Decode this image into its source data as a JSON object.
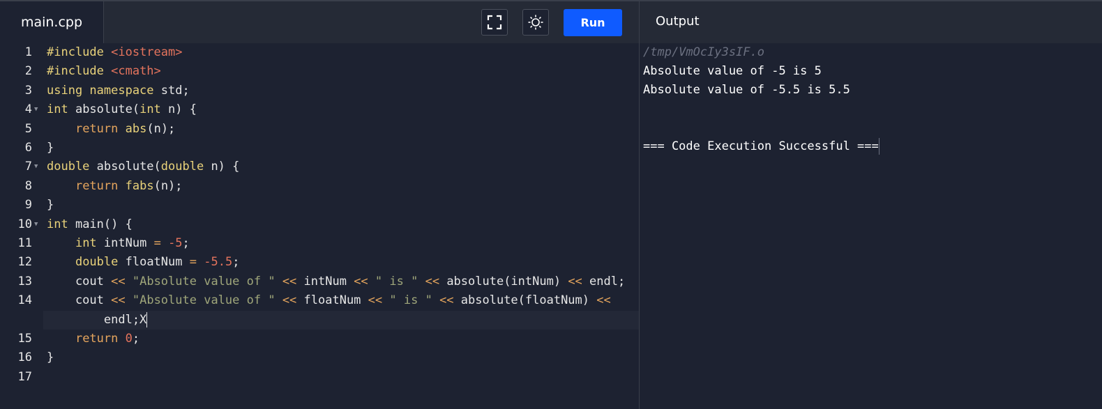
{
  "editor": {
    "filename": "main.cpp",
    "lines": [
      {
        "n": "1",
        "parts": [
          {
            "t": "#include ",
            "c": "kw"
          },
          {
            "t": "<iostream>",
            "c": "inc"
          }
        ]
      },
      {
        "n": "2",
        "parts": [
          {
            "t": "#include ",
            "c": "kw"
          },
          {
            "t": "<cmath>",
            "c": "inc"
          }
        ]
      },
      {
        "n": "3",
        "parts": [
          {
            "t": "using namespace ",
            "c": "kw"
          },
          {
            "t": "std;",
            "c": ""
          }
        ]
      },
      {
        "n": "4",
        "fold": true,
        "parts": [
          {
            "t": "int",
            "c": "kw"
          },
          {
            "t": " absolute(",
            "c": ""
          },
          {
            "t": "int",
            "c": "kw"
          },
          {
            "t": " n) {",
            "c": ""
          }
        ]
      },
      {
        "n": "5",
        "parts": [
          {
            "t": "    ",
            "c": ""
          },
          {
            "t": "return",
            "c": "op"
          },
          {
            "t": " ",
            "c": ""
          },
          {
            "t": "abs",
            "c": "fn"
          },
          {
            "t": "(n);",
            "c": ""
          }
        ]
      },
      {
        "n": "6",
        "parts": [
          {
            "t": "}",
            "c": ""
          }
        ]
      },
      {
        "n": "7",
        "fold": true,
        "parts": [
          {
            "t": "double",
            "c": "kw"
          },
          {
            "t": " absolute(",
            "c": ""
          },
          {
            "t": "double",
            "c": "kw"
          },
          {
            "t": " n) {",
            "c": ""
          }
        ]
      },
      {
        "n": "8",
        "parts": [
          {
            "t": "    ",
            "c": ""
          },
          {
            "t": "return",
            "c": "op"
          },
          {
            "t": " ",
            "c": ""
          },
          {
            "t": "fabs",
            "c": "fn"
          },
          {
            "t": "(n);",
            "c": ""
          }
        ]
      },
      {
        "n": "9",
        "parts": [
          {
            "t": "}",
            "c": ""
          }
        ]
      },
      {
        "n": "10",
        "fold": true,
        "parts": [
          {
            "t": "int",
            "c": "kw"
          },
          {
            "t": " main() {",
            "c": ""
          }
        ]
      },
      {
        "n": "11",
        "parts": [
          {
            "t": "    ",
            "c": ""
          },
          {
            "t": "int",
            "c": "kw"
          },
          {
            "t": " intNum ",
            "c": ""
          },
          {
            "t": "=",
            "c": "op"
          },
          {
            "t": " ",
            "c": ""
          },
          {
            "t": "-5",
            "c": "num"
          },
          {
            "t": ";",
            "c": ""
          }
        ]
      },
      {
        "n": "12",
        "parts": [
          {
            "t": "    ",
            "c": ""
          },
          {
            "t": "double",
            "c": "kw"
          },
          {
            "t": " floatNum ",
            "c": ""
          },
          {
            "t": "=",
            "c": "op"
          },
          {
            "t": " ",
            "c": ""
          },
          {
            "t": "-5.5",
            "c": "num"
          },
          {
            "t": ";",
            "c": ""
          }
        ]
      },
      {
        "n": "13",
        "parts": [
          {
            "t": "    cout ",
            "c": ""
          },
          {
            "t": "<<",
            "c": "op"
          },
          {
            "t": " ",
            "c": ""
          },
          {
            "t": "\"Absolute value of \"",
            "c": "str"
          },
          {
            "t": " ",
            "c": ""
          },
          {
            "t": "<<",
            "c": "op"
          },
          {
            "t": " intNum ",
            "c": ""
          },
          {
            "t": "<<",
            "c": "op"
          },
          {
            "t": " ",
            "c": ""
          },
          {
            "t": "\" is \"",
            "c": "str"
          },
          {
            "t": " ",
            "c": ""
          },
          {
            "t": "<<",
            "c": "op"
          },
          {
            "t": " absolute(intNum) ",
            "c": ""
          },
          {
            "t": "<<",
            "c": "op"
          },
          {
            "t": " endl;",
            "c": ""
          }
        ]
      },
      {
        "n": "14",
        "parts": [
          {
            "t": "    cout ",
            "c": ""
          },
          {
            "t": "<<",
            "c": "op"
          },
          {
            "t": " ",
            "c": ""
          },
          {
            "t": "\"Absolute value of \"",
            "c": "str"
          },
          {
            "t": " ",
            "c": ""
          },
          {
            "t": "<<",
            "c": "op"
          },
          {
            "t": " floatNum ",
            "c": ""
          },
          {
            "t": "<<",
            "c": "op"
          },
          {
            "t": " ",
            "c": ""
          },
          {
            "t": "\" is \"",
            "c": "str"
          },
          {
            "t": " ",
            "c": ""
          },
          {
            "t": "<<",
            "c": "op"
          },
          {
            "t": " absolute(floatNum) ",
            "c": ""
          },
          {
            "t": "<<",
            "c": "op"
          }
        ]
      },
      {
        "n": "",
        "active": true,
        "parts": [
          {
            "t": "        endl;X",
            "c": ""
          }
        ],
        "caret": true
      },
      {
        "n": "15",
        "parts": [
          {
            "t": "    ",
            "c": ""
          },
          {
            "t": "return",
            "c": "op"
          },
          {
            "t": " ",
            "c": ""
          },
          {
            "t": "0",
            "c": "num"
          },
          {
            "t": ";",
            "c": ""
          }
        ]
      },
      {
        "n": "16",
        "parts": [
          {
            "t": "}",
            "c": ""
          }
        ]
      },
      {
        "n": "17",
        "parts": []
      }
    ]
  },
  "toolbar": {
    "fullscreen_icon": "fullscreen-icon",
    "theme_icon": "sun-icon",
    "run_label": "Run",
    "run_color": "#0f5bff"
  },
  "output": {
    "title": "Output",
    "path": "/tmp/VmOcIy3sIF.o",
    "lines": [
      "Absolute value of -5 is 5",
      "Absolute value of -5.5 is 5.5",
      "",
      "",
      "=== Code Execution Successful ==="
    ]
  }
}
